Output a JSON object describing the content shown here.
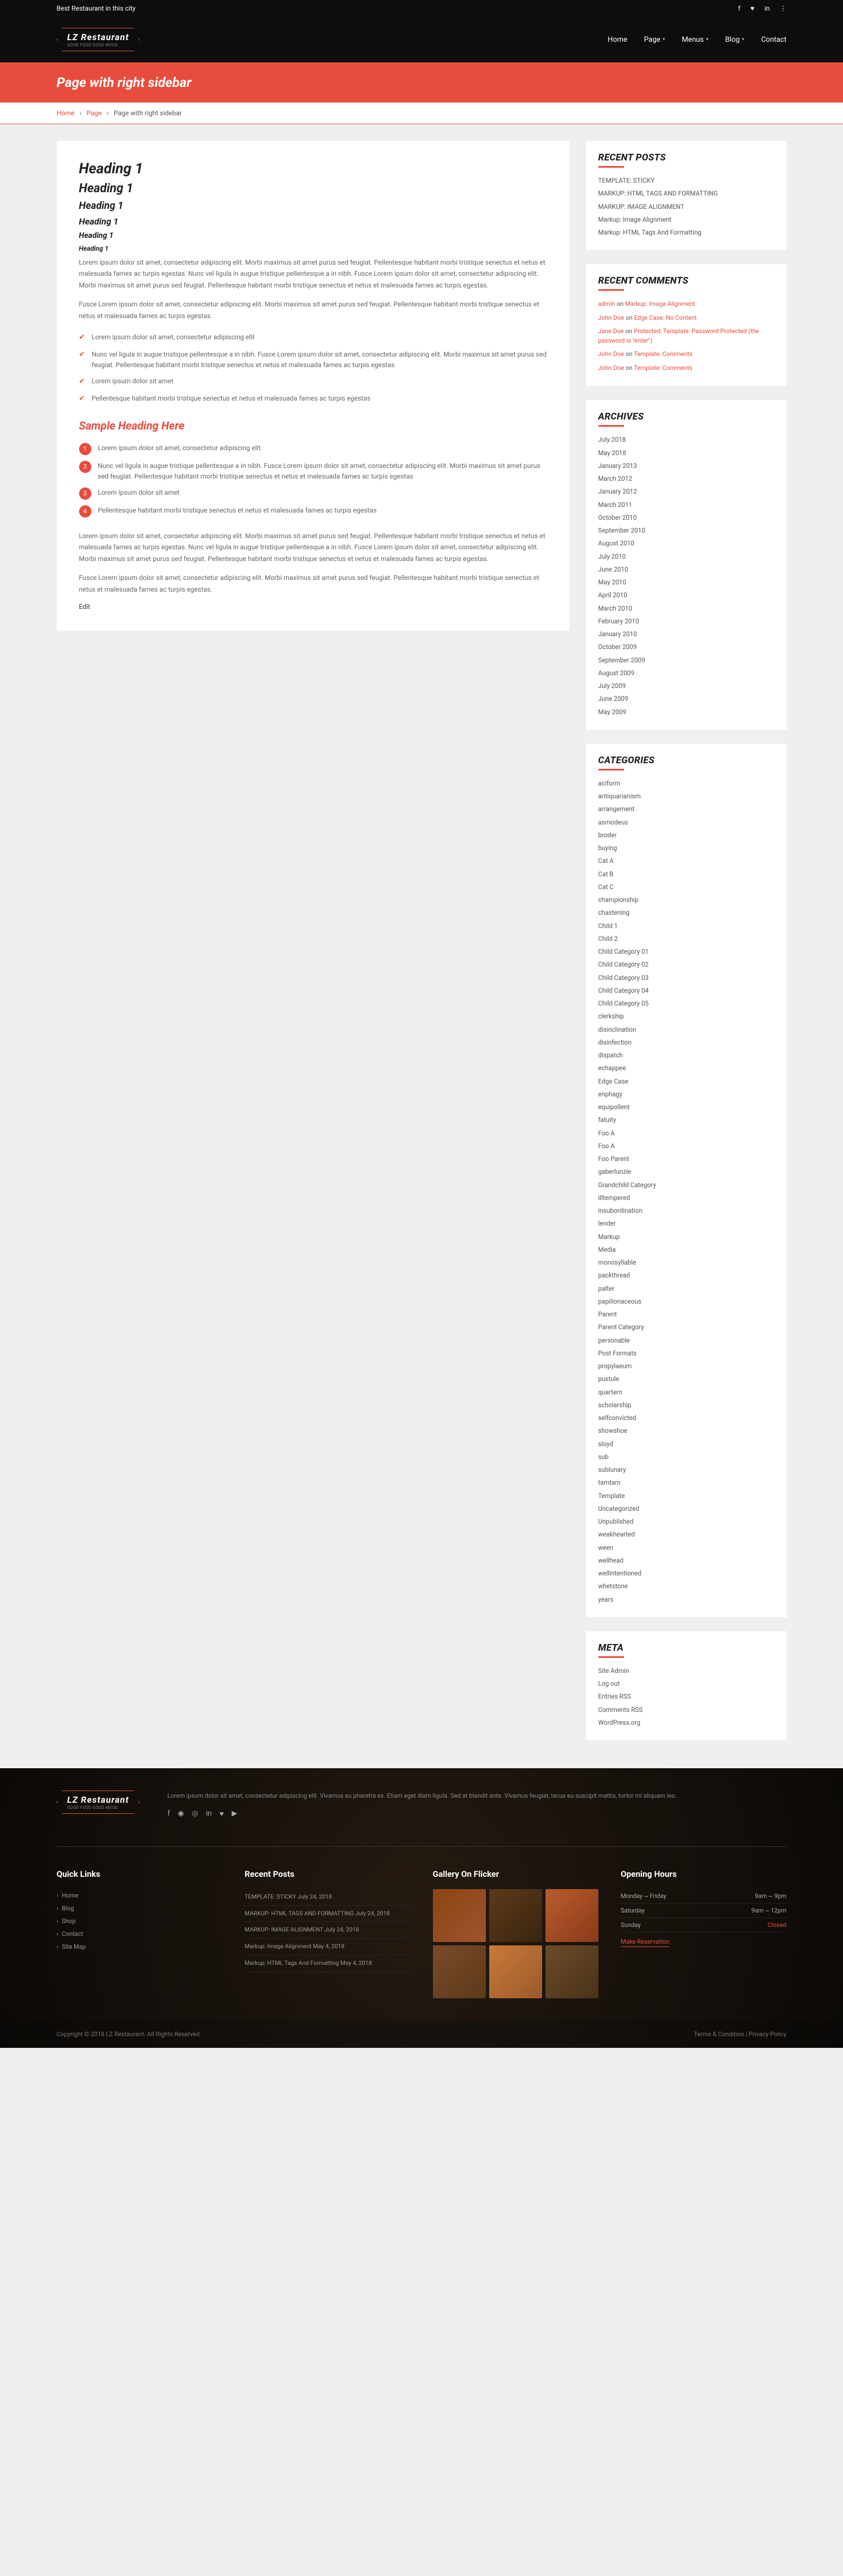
{
  "topbar": {
    "tagline": "Best Restaurant in this city"
  },
  "brand": {
    "name": "LZ Restaurant",
    "sub": "GOOD FOOD GOOD MOOD"
  },
  "nav": {
    "home": "Home",
    "page": "Page",
    "menus": "Menus",
    "blog": "Blog",
    "contact": "Contact"
  },
  "title": "Page with right sidebar",
  "breadcrumb": {
    "home": "Home",
    "page": "Page",
    "current": "Page with right sidebar"
  },
  "content": {
    "h1": "Heading 1",
    "h2": "Heading 1",
    "h3": "Heading 1",
    "h4": "Heading 1",
    "h5": "Heading 1",
    "h6": "Heading 1",
    "p1": "Lorem ipsum dolor sit amet, consectetur adipiscing elit. Morbi maximus sit amet purus sed feugiat. Pellentesque habitant morbi tristique senectus et netus et malesuada fames ac turpis egestas. Nunc vel ligula in augue tristique pellentesque a in nibh. Fusce Lorem ipsum dolor sit amet, consectetur adipiscing elit. Morbi maximus sit amet purus sed feugiat. Pellentesque habitant morbi tristique senectus et netus et malesuada fames ac turpis egestas.",
    "p2": "Fusce Lorem ipsum dolor sit amet, consectetur adipiscing elit. Morbi maximus sit amet purus sed feugiat. Pellentesque habitant morbi tristique senectus et netus et malesuada fames ac turpis egestas.",
    "check": [
      "Lorem ipsum dolor sit amet, consectetur adipiscing elit",
      "Nunc vel ligula in augue tristique pellentesque a in nibh. Fusce Lorem ipsum dolor sit amet, consectetur adipiscing elit. Morbi maximus sit amet purus sed feugiat. Pellentesque habitant morbi tristique senectus et netus et malesuada fames ac turpis egestas",
      "Lorem ipsum dolor sit amet",
      "Pellentesque habitant morbi tristique senectus et netus et malesuada fames ac turpis egestas"
    ],
    "sample": "Sample Heading Here",
    "num": [
      "Lorem ipsum dolor sit amet, consectetur adipiscing elit",
      "Nunc vel ligula in augue tristique pellentesque a in nibh. Fusce Lorem ipsum dolor sit amet, consectetur adipiscing elit. Morbi maximus sit amet purus sed feugiat. Pellentesque habitant morbi tristique senectus et netus et malesuada fames ac turpis egestas",
      "Lorem ipsum dolor sit amet",
      "Pellentesque habitant morbi tristique senectus et netus et malesuada fames ac turpis egestas"
    ],
    "p3": "Lorem ipsum dolor sit amet, consectetur adipiscing elit. Morbi maximus sit amet purus sed feugiat. Pellentesque habitant morbi tristique senectus et netus et malesuada fames ac turpis egestas. Nunc vel ligula in augue tristique pellentesque a in nibh. Fusce Lorem ipsum dolor sit amet, consectetur adipiscing elit. Morbi maximus sit amet purus sed feugiat. Pellentesque habitant morbi tristique senectus et netus et malesuada fames ac turpis egestas.",
    "p4": "Fusce Lorem ipsum dolor sit amet, consectetur adipiscing elit. Morbi maximus sit amet purus sed feugiat. Pellentesque habitant morbi tristique senectus et netus et malesuada fames ac turpis egestas.",
    "edit": "Edit"
  },
  "sidebar": {
    "recent_posts": {
      "title": "RECENT POSTS",
      "items": [
        "TEMPLATE: STICKY",
        "MARKUP: HTML TAGS AND FORMATTING",
        "MARKUP: IMAGE ALIGNMENT",
        "Markup: Image Alignment",
        "Markup: HTML Tags And Formatting"
      ]
    },
    "recent_comments": {
      "title": "RECENT COMMENTS",
      "items": [
        {
          "who": "admin",
          "post": "Markup: Image Alignment"
        },
        {
          "who": "John Doe",
          "post": "Edge Case: No Content"
        },
        {
          "who": "Jane Doe",
          "post": "Protected: Template: Password Protected (the password is \"enter\")"
        },
        {
          "who": "John Doe",
          "post": "Template: Comments"
        },
        {
          "who": "John Doe",
          "post": "Template: Comments"
        }
      ]
    },
    "archives": {
      "title": "ARCHIVES",
      "items": [
        "July 2018",
        "May 2018",
        "January 2013",
        "March 2012",
        "January 2012",
        "March 2011",
        "October 2010",
        "September 2010",
        "August 2010",
        "July 2010",
        "June 2010",
        "May 2010",
        "April 2010",
        "March 2010",
        "February 2010",
        "January 2010",
        "October 2009",
        "September 2009",
        "August 2009",
        "July 2009",
        "June 2009",
        "May 2009"
      ]
    },
    "categories": {
      "title": "CATEGORIES",
      "items": [
        "aciform",
        "antiquarianism",
        "arrangement",
        "asmodeus",
        "broder",
        "buying",
        "Cat A",
        "Cat B",
        "Cat C",
        "championship",
        "chastening",
        "Child 1",
        "Child 2",
        "Child Category 01",
        "Child Category 02",
        "Child Category 03",
        "Child Category 04",
        "Child Category 05",
        "clerkship",
        "disinclination",
        "disinfection",
        "dispatch",
        "echappee",
        "Edge Case",
        "enphagy",
        "equipollent",
        "fatuity",
        "Foo A",
        "Foo A",
        "Foo Parent",
        "gaberlunzie",
        "Grandchild Category",
        "illtempered",
        "insubordination",
        "lender",
        "Markup",
        "Media",
        "monosyllable",
        "packthread",
        "palter",
        "papilionaceous",
        "Parent",
        "Parent Category",
        "personable",
        "Post Formats",
        "propylaeum",
        "pustule",
        "quartern",
        "scholarship",
        "selfconvicted",
        "showshoe",
        "sloyd",
        "sub",
        "sublunary",
        "tamtam",
        "Template",
        "Uncategorized",
        "Unpublished",
        "weakhearted",
        "ween",
        "wellhead",
        "wellintentioned",
        "whetstone",
        "years"
      ]
    },
    "meta": {
      "title": "META",
      "items": [
        "Site Admin",
        "Log out",
        "Entries RSS",
        "Comments RSS",
        "WordPress.org"
      ]
    }
  },
  "footer": {
    "about": "Lorem ipsum dolor sit amet, consectetur adipiscing elit. Vivamus eu pharetra ex. Etiam eget diam ligula. Sed at blandit ante. Vivamus feugiat, lacus eu suscipit mattis, tortor mi aliquam leo.",
    "quick": {
      "title": "Quick Links",
      "items": [
        "Home",
        "Blog",
        "Shop",
        "Contact",
        "Site Map"
      ]
    },
    "posts": {
      "title": "Recent Posts",
      "items": [
        "TEMPLATE: STICKY July 24, 2018",
        "MARKUP: HTML TAGS AND FORMATTING July 24, 2018",
        "MARKUP: IMAGE ALIGNMENT July 24, 2018",
        "Markup: Image Alignment May 4, 2018",
        "Markup: HTML Tags And Formatting May 4, 2018"
      ]
    },
    "gallery": {
      "title": "Gallery On Flicker"
    },
    "hours": {
      "title": "Opening Hours",
      "rows": [
        {
          "d": "Monday ~ Friday",
          "t": "9am ~ 9pm"
        },
        {
          "d": "Saturday",
          "t": "9am ~ 12pm"
        },
        {
          "d": "Sunday",
          "t": "Closed"
        }
      ],
      "reserve": "Make Reservation"
    },
    "copy": "Copyright © 2018 LZ Restaurant. All Rights Reserved",
    "terms": "Terms & Condition",
    "priv": "Privacy Policy"
  }
}
